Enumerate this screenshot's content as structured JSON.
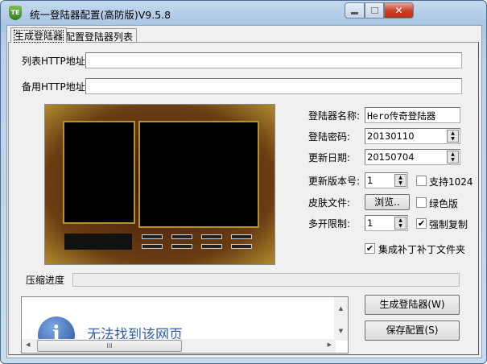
{
  "window": {
    "title": "统一登陆器配置(高防版)V9.5.8",
    "icon_text": "TE"
  },
  "tabs": [
    {
      "label": "生成登陆器",
      "active": true
    },
    {
      "label": "配置登陆器列表",
      "active": false
    }
  ],
  "fields": {
    "list_http": {
      "label": "列表HTTP地址",
      "value": ""
    },
    "backup_http": {
      "label": "备用HTTP地址",
      "value": ""
    },
    "name": {
      "label": "登陆器名称:",
      "value": "Hero传奇登陆器"
    },
    "password": {
      "label": "登陆密码:",
      "value": "20130110"
    },
    "update_date": {
      "label": "更新日期:",
      "value": "20150704"
    },
    "version": {
      "label": "更新版本号:",
      "value": "1"
    },
    "skin": {
      "label": "皮肤文件:",
      "button": "浏览.."
    },
    "multi": {
      "label": "多开限制:",
      "value": "1"
    }
  },
  "checkboxes": {
    "support1024": {
      "label": "支持1024",
      "checked": false
    },
    "green": {
      "label": "绿色版",
      "checked": false
    },
    "force_copy": {
      "label": "强制复制",
      "checked": true
    },
    "patch": {
      "label": "集成补丁补丁文件夹",
      "checked": true
    }
  },
  "progress": {
    "label": "压缩进度",
    "value": 0
  },
  "web": {
    "message": "无法找到该网页"
  },
  "buttons": {
    "generate": "生成登陆器(W)",
    "save": "保存配置(S)"
  }
}
